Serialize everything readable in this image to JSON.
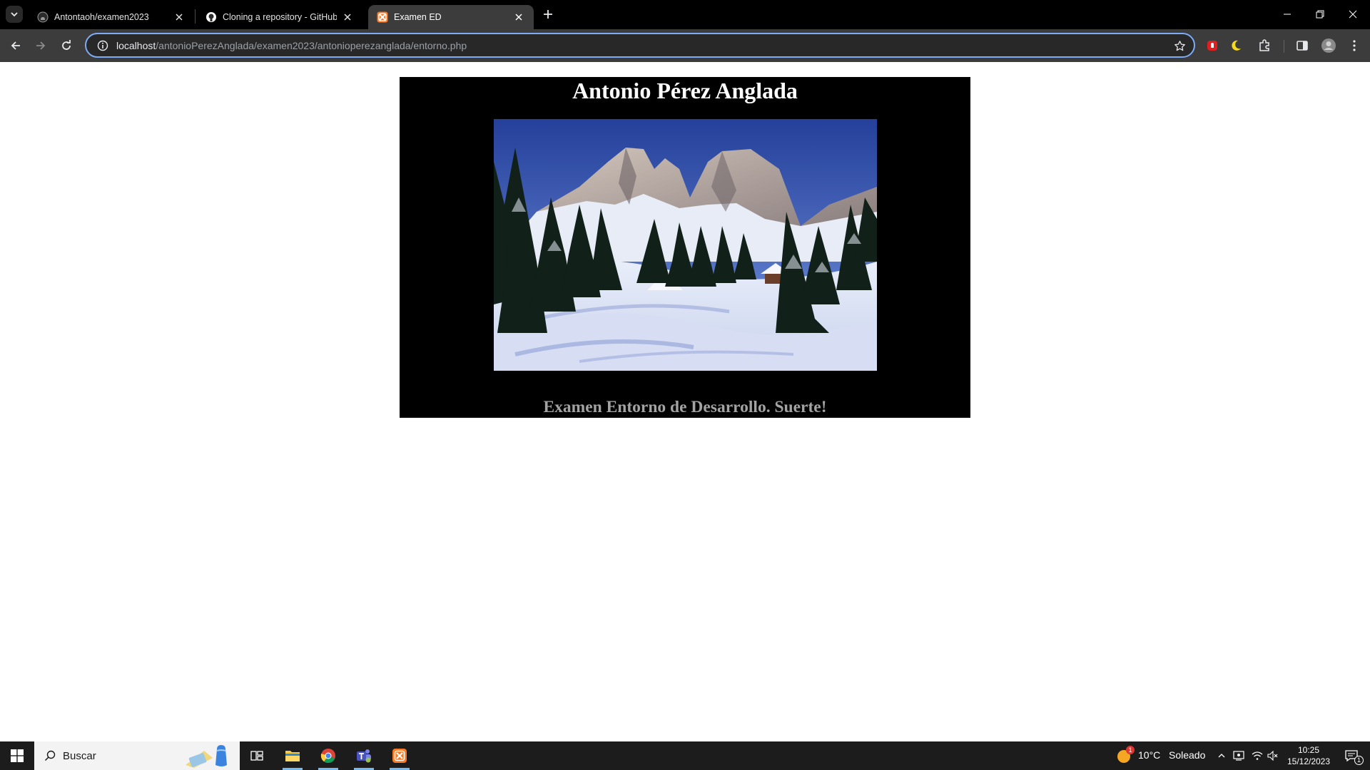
{
  "browser": {
    "tabs": [
      {
        "title": "Antontaoh/examen2023",
        "favicon": "github-icon"
      },
      {
        "title": "Cloning a repository - GitHub D",
        "favicon": "github-desktop-icon"
      },
      {
        "title": "Examen ED",
        "favicon": "xampp-icon"
      }
    ],
    "active_tab": 2,
    "address": {
      "host": "localhost",
      "path": "/antonioPerezAnglada/examen2023/antonioperezanglada/entorno.php"
    }
  },
  "page": {
    "heading": "Antonio Pérez Anglada",
    "image_description_icon": "snowy-mountain-landscape",
    "subtitle": "Examen Entorno de Desarrollo. Suerte!"
  },
  "taskbar": {
    "search_placeholder": "Buscar",
    "weather": {
      "temperature": "10°C",
      "condition": "Soleado",
      "alert_count": "1"
    },
    "time": "10:25",
    "date": "15/12/2023",
    "notification_count": "1"
  },
  "colors": {
    "tab_strip": "#000000",
    "toolbar": "#3c3c3c",
    "omnibox_border": "#7cacf8",
    "card_background": "#000000",
    "subtitle": "#a3a3a3",
    "taskbar": "#1c1c1c"
  }
}
